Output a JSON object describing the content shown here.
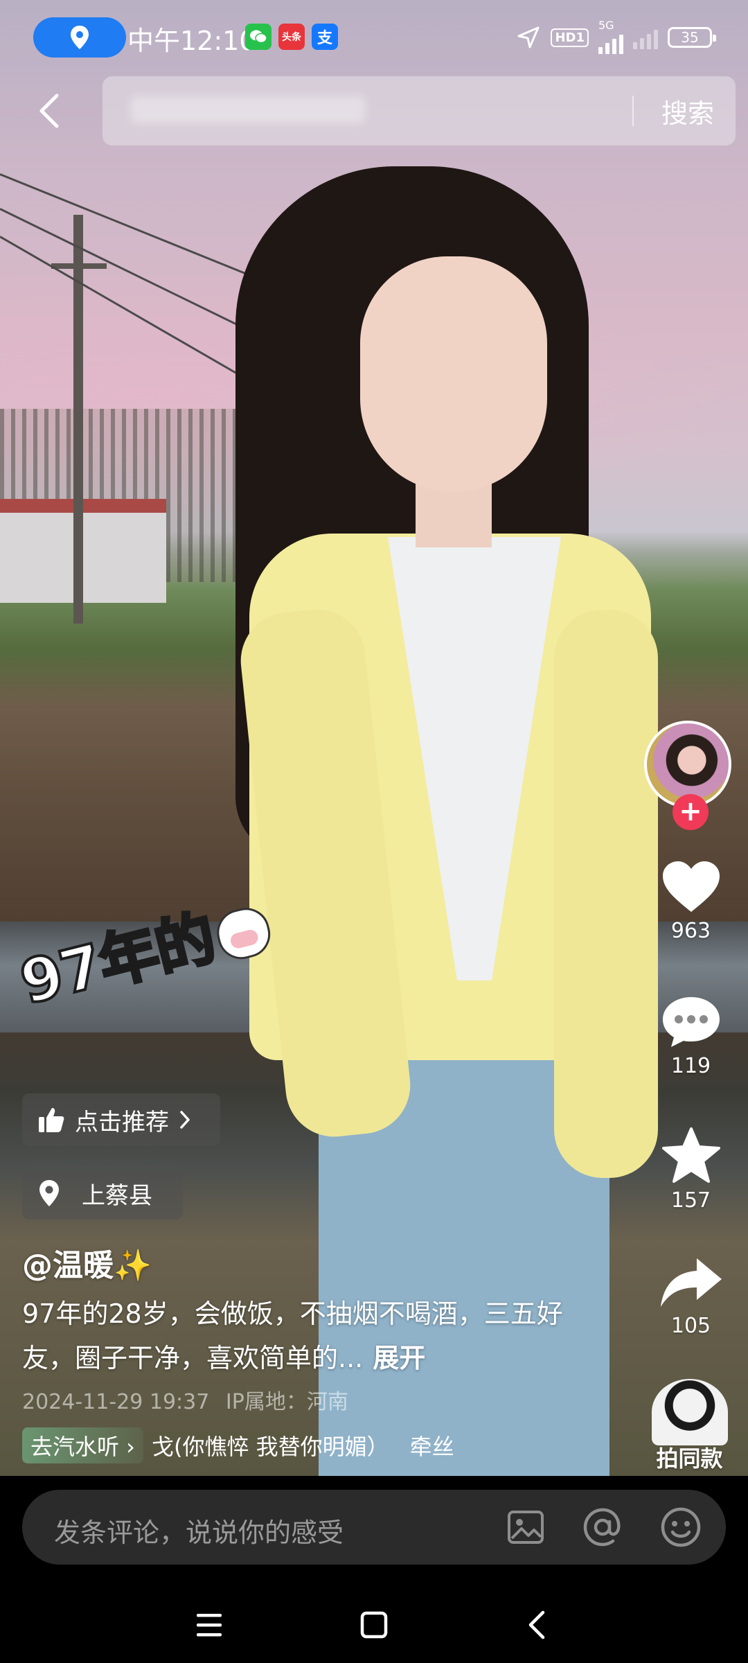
{
  "status_bar": {
    "location_icon": "location-pin-icon",
    "time": "中午12:10",
    "apps": [
      {
        "name": "wechat-icon",
        "glyph": "●",
        "color": "#27c24c"
      },
      {
        "name": "toutiao-icon",
        "glyph": "头条",
        "color": "#e8343b"
      },
      {
        "name": "alipay-icon",
        "glyph": "支",
        "color": "#1678ff"
      }
    ],
    "hd_label": "HD1",
    "network_label": "5G",
    "battery": "35"
  },
  "search": {
    "button_label": "搜索"
  },
  "rail": {
    "like_count": "963",
    "comment_count": "119",
    "favorite_count": "157",
    "share_count": "105",
    "same_style_label": "拍同款"
  },
  "video": {
    "sticker_text": "97年的"
  },
  "chips": {
    "recommend_label": "点击推荐",
    "location_label": "上蔡县"
  },
  "post": {
    "author": "@温暖✨",
    "description": "97年的28岁，会做饭，不抽烟不喝酒，三五好友，圈子干净，喜欢简单的...",
    "expand_label": "展开",
    "date": "2024-11-29 19:37",
    "ip_location": "IP属地：河南"
  },
  "music": {
    "chip_label": "去汽水听 ›",
    "track": "戈(你憔悴 我替你明媚）",
    "artist": "牵丝"
  },
  "comment_bar": {
    "placeholder": "发条评论，说说你的感受"
  },
  "colors": {
    "accent_follow": "#f03a57",
    "location_pill": "#1f7cf2",
    "comment_bar_bg": "#2b2b2b"
  }
}
